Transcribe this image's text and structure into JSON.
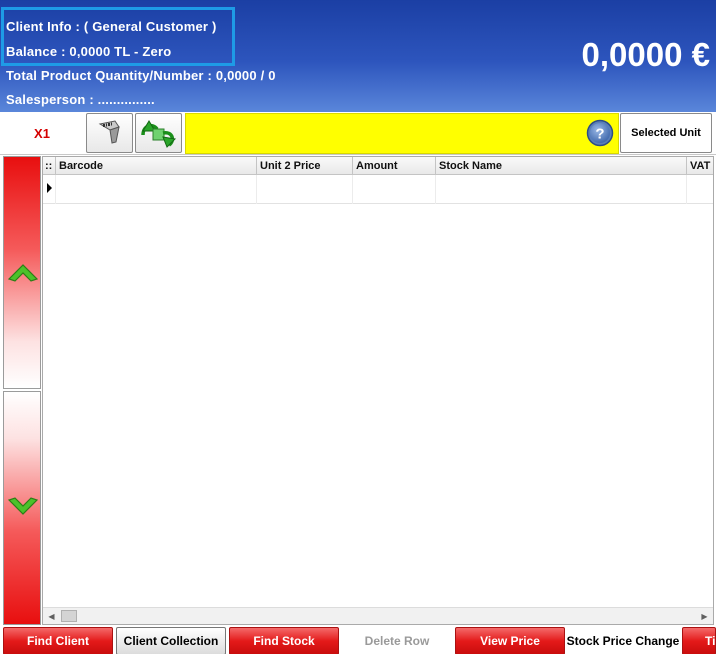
{
  "header": {
    "client_info": "Client Info : ( General Customer )",
    "balance": "Balance : 0,0000 TL - Zero",
    "total_quantity": "Total Product Quantity/Number : 0,0000  /  0",
    "salesperson": "Salesperson : ...............",
    "total_amount": "0,0000 €"
  },
  "toolbar": {
    "multiplier": "X1",
    "barcode_scanner_icon": "barcode-scanner-icon",
    "refresh_icon": "refresh-arrows-icon",
    "barcode_input_value": "",
    "help_icon": "help-icon",
    "selected_unit_label": "Selected Unit"
  },
  "navigation": {
    "up_icon": "chevron-up-icon",
    "down_icon": "chevron-down-icon"
  },
  "grid": {
    "corner": "::",
    "columns": [
      "Barcode",
      "Unit 2 Price",
      "Amount",
      "Stock Name",
      "VAT"
    ],
    "rows": [
      [
        "",
        "",
        "",
        "",
        ""
      ]
    ]
  },
  "bottom_buttons": [
    {
      "label": "Find Client",
      "style": "red"
    },
    {
      "label": "Client Collection",
      "style": "gray"
    },
    {
      "label": "Find Stock",
      "style": "red"
    },
    {
      "label": "Delete Row",
      "style": "disabled"
    },
    {
      "label": "View Price",
      "style": "red"
    },
    {
      "label": "Stock Price Change",
      "style": "white"
    },
    {
      "label": "Ti",
      "style": "red"
    }
  ],
  "colors": {
    "header_blue": "#2d55bd",
    "client_box_border": "#1e9be6",
    "barcode_input_yellow": "#ffff00",
    "action_red": "#e41a1a",
    "multiplier_red": "#d40000"
  }
}
